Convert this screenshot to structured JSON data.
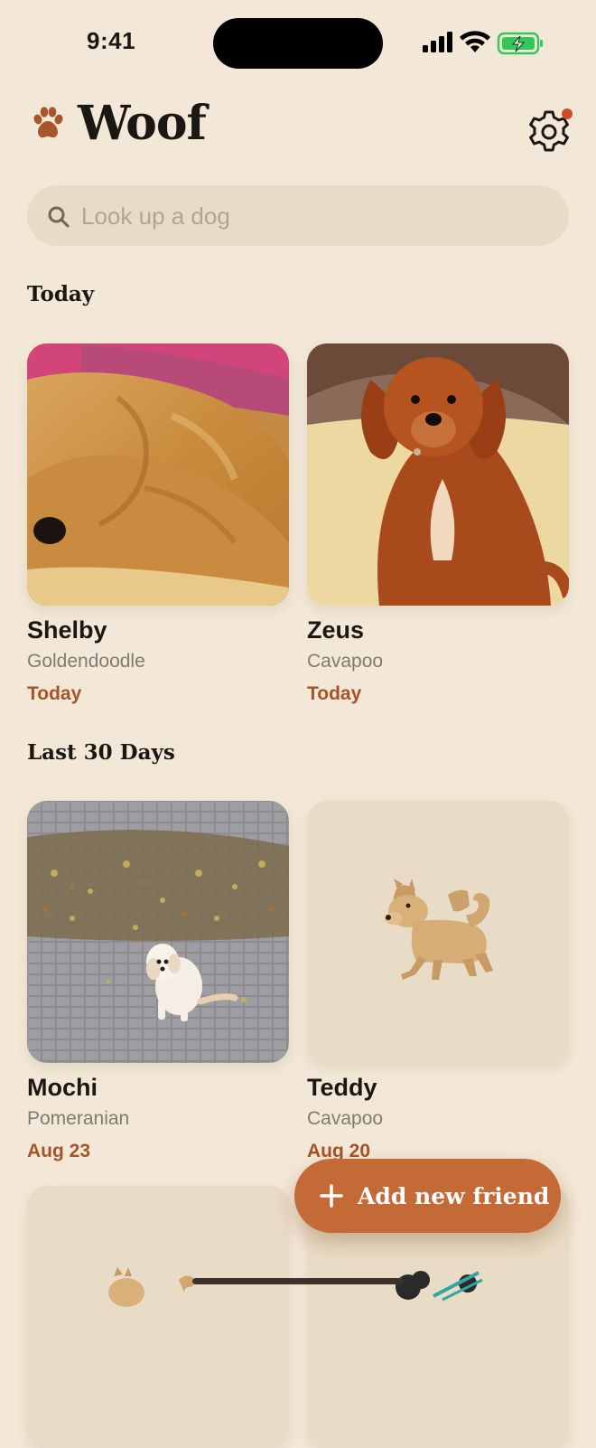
{
  "status_bar": {
    "time": "9:41"
  },
  "header": {
    "title": "Woof"
  },
  "search": {
    "placeholder": "Look up a dog",
    "value": ""
  },
  "sections": {
    "today": {
      "title": "Today",
      "dogs": [
        {
          "name": "Shelby",
          "breed": "Goldendoodle",
          "date": "Today"
        },
        {
          "name": "Zeus",
          "breed": "Cavapoo",
          "date": "Today"
        }
      ]
    },
    "last30": {
      "title": "Last 30 Days",
      "dogs": [
        {
          "name": "Mochi",
          "breed": "Pomeranian",
          "date": "Aug 23"
        },
        {
          "name": "Teddy",
          "breed": "Cavapoo",
          "date": "Aug 20",
          "icon": "dog-emoji-icon"
        }
      ]
    }
  },
  "fab": {
    "label": "Add new friend"
  },
  "colors": {
    "background": "#f3e8d7",
    "accent": "#c36a36",
    "date_text": "#a4532a",
    "search_bg": "#e8dcc7",
    "notification_dot": "#d24a2e",
    "battery": "#34c759"
  }
}
